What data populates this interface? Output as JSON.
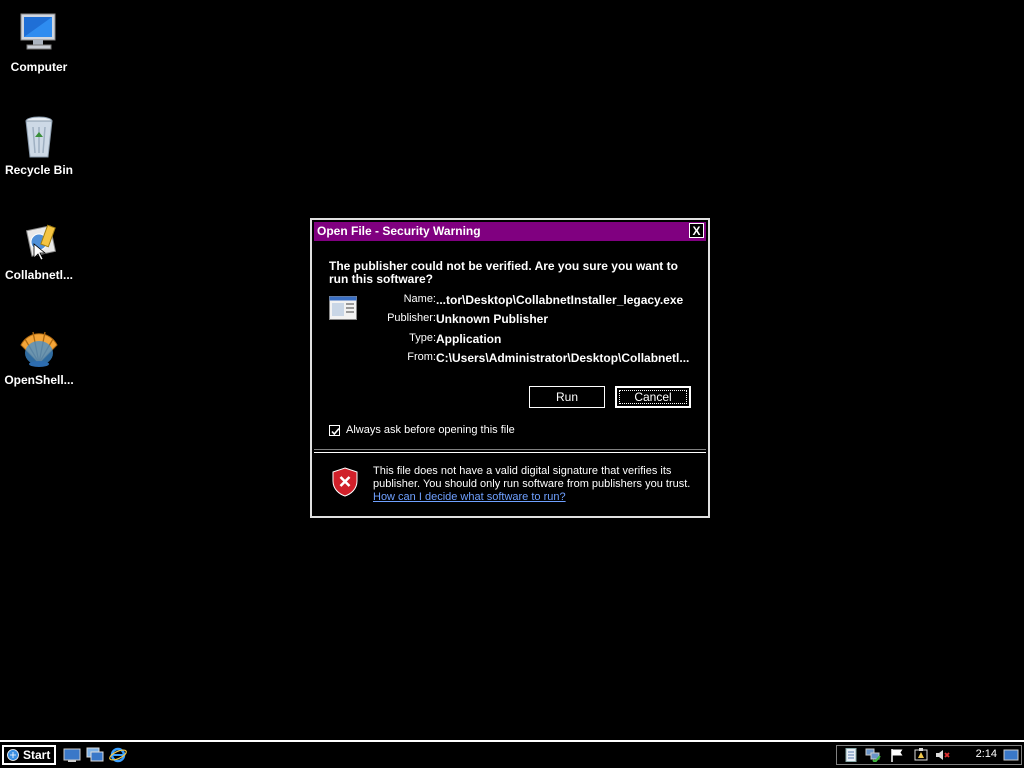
{
  "desktop": {
    "icons": [
      {
        "label": "Computer",
        "icon": "computer-icon"
      },
      {
        "label": "Recycle Bin",
        "icon": "recycle-bin-icon"
      },
      {
        "label": "Collabnetl...",
        "icon": "installer-icon"
      },
      {
        "label": "OpenShell...",
        "icon": "openshell-icon"
      }
    ]
  },
  "dialog": {
    "title": "Open File - Security Warning",
    "close_symbol": "X",
    "question": "The publisher could not be verified.  Are you sure you want to run this software?",
    "fields": [
      {
        "key": "Name:",
        "value": "...tor\\Desktop\\CollabnetInstaller_legacy.exe"
      },
      {
        "key": "Publisher:",
        "value": "Unknown Publisher"
      },
      {
        "key": "Type:",
        "value": "Application"
      },
      {
        "key": "From:",
        "value": "C:\\Users\\Administrator\\Desktop\\Collabnetl..."
      }
    ],
    "run_label": "Run",
    "cancel_label": "Cancel",
    "checkbox_label": "Always ask before opening this file",
    "checkbox_checked": true,
    "warning_text": "This file does not have a valid digital signature that verifies its publisher.  You should only run software from publishers you trust.",
    "warning_link": "How can I decide what software to run?"
  },
  "taskbar": {
    "start_label": "Start",
    "quick_launch": [
      "show-desktop-icon",
      "switch-windows-icon",
      "internet-explorer-icon"
    ],
    "tray_icons": [
      "document-icon",
      "network-icon",
      "flag-icon",
      "power-icon",
      "volume-muted-icon"
    ],
    "clock": "2:14"
  },
  "colors": {
    "titlebar": "#800080",
    "background": "#000000",
    "link": "#6fa0ff",
    "shield": "#d0202a"
  }
}
